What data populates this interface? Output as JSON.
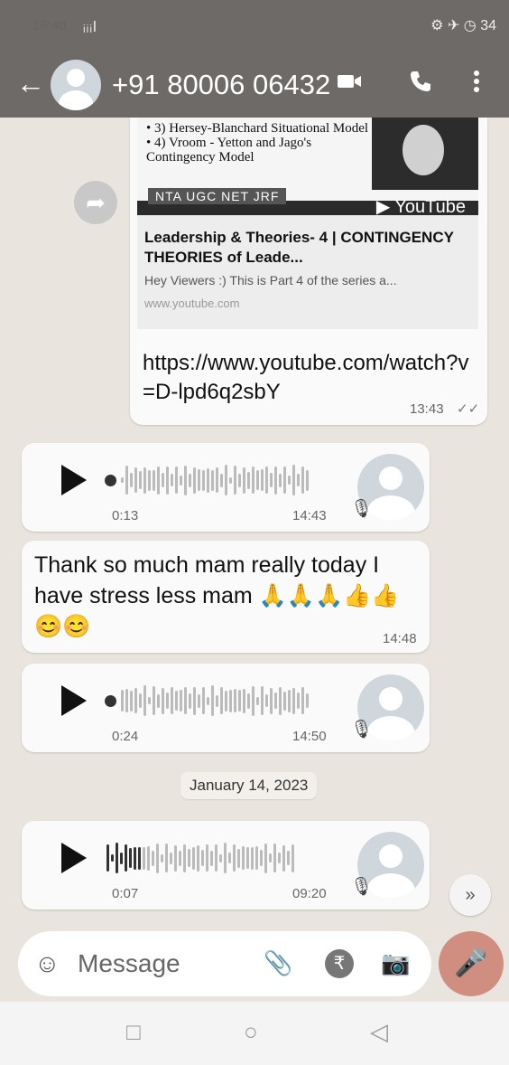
{
  "status_bar": {
    "time": "16:40",
    "signal": "ᵢᵢᵢl",
    "right_icons": "⚙ ✈ ◷ 34"
  },
  "header": {
    "back_icon": "←",
    "contact": "+91 80006 06432",
    "video_icon": "video-call-icon",
    "call_icon": "phone-icon",
    "menu_icon": "more-icon"
  },
  "messages": {
    "link_card": {
      "thumb_lines": [
        "• 3) Hersey-Blanchard Situational Model",
        "• 4) Vroom - Yetton and Jago's Contingency Model"
      ],
      "thumb_tag": "NTA UGC NET JRF",
      "youtube_label": "YouTube",
      "title": "Leadership & Theories- 4 | CONTINGENCY THEORIES of Leade...",
      "description": "Hey Viewers :) This is Part 4 of the series a...",
      "domain": "www.youtube.com",
      "url": "https://www.youtube.com/watch?v=D-lpd6q2sbY",
      "time": "13:43",
      "ticks": "✓✓"
    },
    "voice1": {
      "duration": "0:13",
      "time": "14:43"
    },
    "text1": {
      "text": "Thank so much mam  really today I have stress less mam 🙏🙏🙏👍👍😊😊",
      "time": "14:48"
    },
    "voice2": {
      "duration": "0:24",
      "time": "14:50"
    },
    "date_chip": "January 14, 2023",
    "voice3": {
      "duration": "0:07",
      "time": "09:20"
    }
  },
  "composer": {
    "placeholder": "Message",
    "emoji_icon": "☺",
    "attach_icon": "📎",
    "rupee_icon": "₹",
    "camera_icon": "📷",
    "mic_icon": "🎤"
  },
  "scroll_down_icon": "»",
  "nav": {
    "recents": "□",
    "home": "○",
    "back": "◁"
  }
}
